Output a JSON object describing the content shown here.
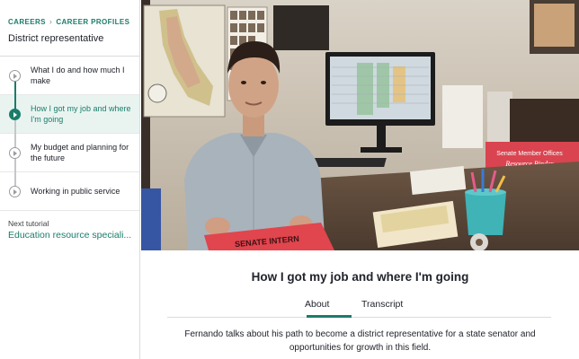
{
  "sidebar": {
    "breadcrumb": {
      "first": "CAREERS",
      "second": "CAREER PROFILES"
    },
    "title": "District representative",
    "steps": [
      {
        "label": "What I do and how much I make",
        "active": false
      },
      {
        "label": "How I got my job and where I'm going",
        "active": true
      },
      {
        "label": "My budget and planning for the future",
        "active": false
      },
      {
        "label": "Working in public service",
        "active": false
      }
    ],
    "next_tutorial": {
      "label": "Next tutorial",
      "link": "Education resource speciali..."
    }
  },
  "video": {
    "binder_title": "Senate Member Offices",
    "binder_subtitle": "Resource Binder",
    "banner_text": "SENATE INTERN"
  },
  "main": {
    "title": "How I got my job and where I'm going",
    "tabs": [
      "About",
      "Transcript"
    ],
    "active_tab": "About",
    "description": "Fernando talks about his path to become a district representative for a state senator and opportunities for growth in this field."
  },
  "colors": {
    "accent": "#1a7d6a",
    "active_bg": "#e9f4f1"
  }
}
